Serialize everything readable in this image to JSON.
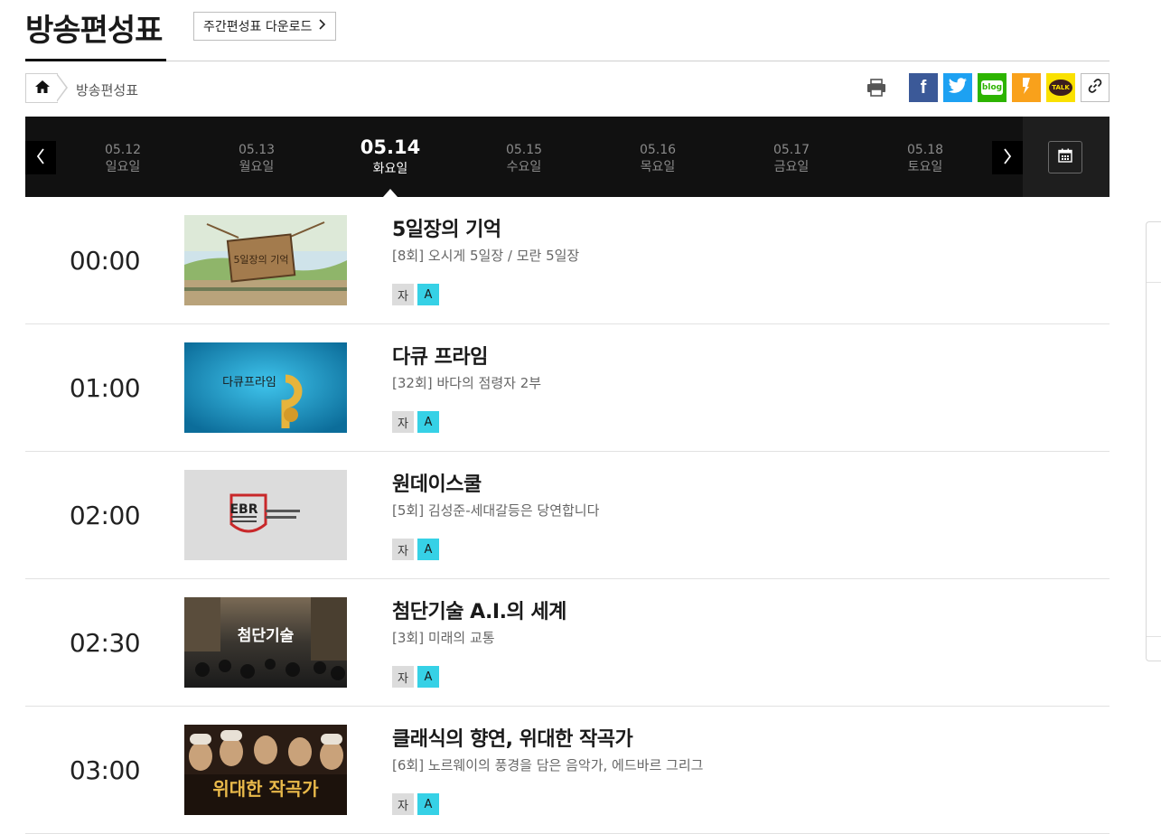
{
  "header": {
    "title": "방송편성표",
    "download_label": "주간편성표 다운로드"
  },
  "breadcrumb": {
    "home_icon": "home-icon",
    "current": "방송편성표"
  },
  "share": {
    "facebook_label": "f",
    "blog_label": "blog",
    "talk_label": "TALK"
  },
  "dates": [
    {
      "date": "05.12",
      "weekday": "일요일"
    },
    {
      "date": "05.13",
      "weekday": "월요일"
    },
    {
      "date": "05.14",
      "weekday": "화요일"
    },
    {
      "date": "05.15",
      "weekday": "수요일"
    },
    {
      "date": "05.16",
      "weekday": "목요일"
    },
    {
      "date": "05.17",
      "weekday": "금요일"
    },
    {
      "date": "05.18",
      "weekday": "토요일"
    }
  ],
  "active_date": "05.14",
  "programs": [
    {
      "time": "00:00",
      "title": "5일장의 기억",
      "desc": "[8회] 오시게 5일장 / 모란 5일장",
      "badges": [
        "자",
        "A"
      ],
      "thumb_text": "5일장의 기억"
    },
    {
      "time": "01:00",
      "title": "다큐 프라임",
      "desc": "[32회] 바다의 점령자 2부",
      "badges": [
        "자",
        "A"
      ],
      "thumb_text": "다큐프라임"
    },
    {
      "time": "02:00",
      "title": "원데이스쿨",
      "desc": "[5회] 김성준-세대갈등은 당연합니다",
      "badges": [
        "자",
        "A"
      ],
      "thumb_text": "EBR"
    },
    {
      "time": "02:30",
      "title": "첨단기술 A.I.의 세계",
      "desc": "[3회] 미래의 교통",
      "badges": [
        "자",
        "A"
      ],
      "thumb_text": "첨단기술"
    },
    {
      "time": "03:00",
      "title": "클래식의 향연, 위대한 작곡가",
      "desc": "[6회] 노르웨이의 풍경을 담은 음악가, 에드바르 그리그",
      "badges": [
        "자",
        "A"
      ],
      "thumb_text": "위대한 작곡가"
    }
  ],
  "colors": {
    "datebar": "#111111",
    "badge_a": "#36d1e6",
    "facebook": "#3b5998",
    "twitter": "#1da1f2",
    "blog": "#2db400",
    "story": "#f9a11b",
    "talk": "#fae100"
  }
}
